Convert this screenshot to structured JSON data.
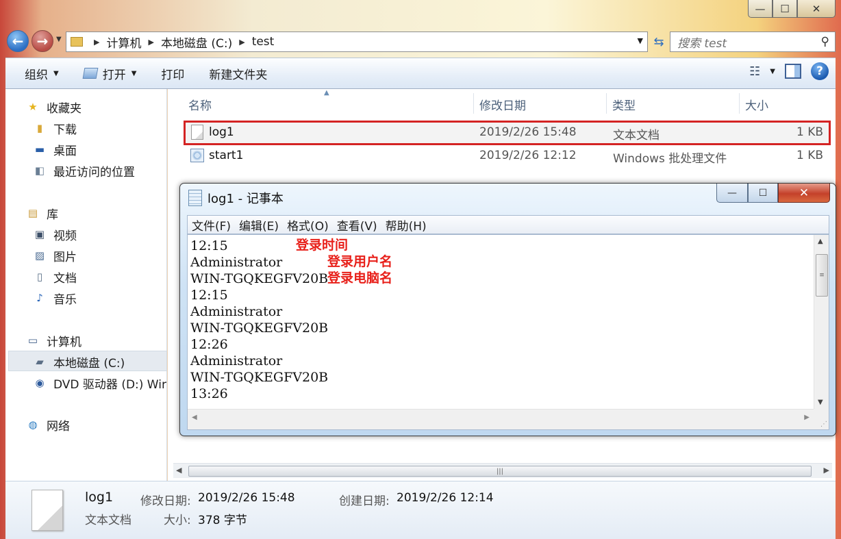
{
  "explorer": {
    "caption": {
      "minimize": "—",
      "maximize": "☐",
      "close": "✕"
    },
    "breadcrumbs": [
      "计算机",
      "本地磁盘 (C:)",
      "test"
    ],
    "search_placeholder": "搜索 test",
    "toolbar": {
      "organize": "组织",
      "open": "打开",
      "print": "打印",
      "new_folder": "新建文件夹"
    },
    "nav": {
      "favorites": "收藏夹",
      "downloads": "下载",
      "desktop": "桌面",
      "recent": "最近访问的位置",
      "libraries": "库",
      "videos": "视频",
      "pictures": "图片",
      "documents": "文档",
      "music": "音乐",
      "computer": "计算机",
      "local_disk": "本地磁盘 (C:)",
      "dvd": "DVD 驱动器 (D:) Wir",
      "network": "网络"
    },
    "columns": {
      "name": "名称",
      "modified": "修改日期",
      "type": "类型",
      "size": "大小"
    },
    "files": [
      {
        "name": "log1",
        "modified": "2019/2/26 15:48",
        "type": "文本文档",
        "size": "1 KB"
      },
      {
        "name": "start1",
        "modified": "2019/2/26 12:12",
        "type": "Windows 批处理文件",
        "size": "1 KB"
      }
    ],
    "details": {
      "name": "log1",
      "type": "文本文档",
      "modified_label": "修改日期:",
      "modified_value": "2019/2/26 15:48",
      "created_label": "创建日期:",
      "created_value": "2019/2/26 12:14",
      "size_label": "大小:",
      "size_value": "378 字节"
    }
  },
  "notepad": {
    "title": "log1 - 记事本",
    "menu": [
      "文件(F)",
      "编辑(E)",
      "格式(O)",
      "查看(V)",
      "帮助(H)"
    ],
    "lines": [
      "12:15",
      "Administrator",
      "WIN-TGQKEGFV20B",
      "12:15",
      "Administrator",
      "WIN-TGQKEGFV20B",
      "12:26",
      "Administrator",
      "WIN-TGQKEGFV20B",
      "13:26"
    ],
    "annotations": {
      "login_time": "登录时间",
      "login_user": "登录用户名",
      "login_computer": "登录电脑名"
    }
  },
  "colors": {
    "highlight_border": "#d42323",
    "annotation_text": "#e8201a"
  }
}
